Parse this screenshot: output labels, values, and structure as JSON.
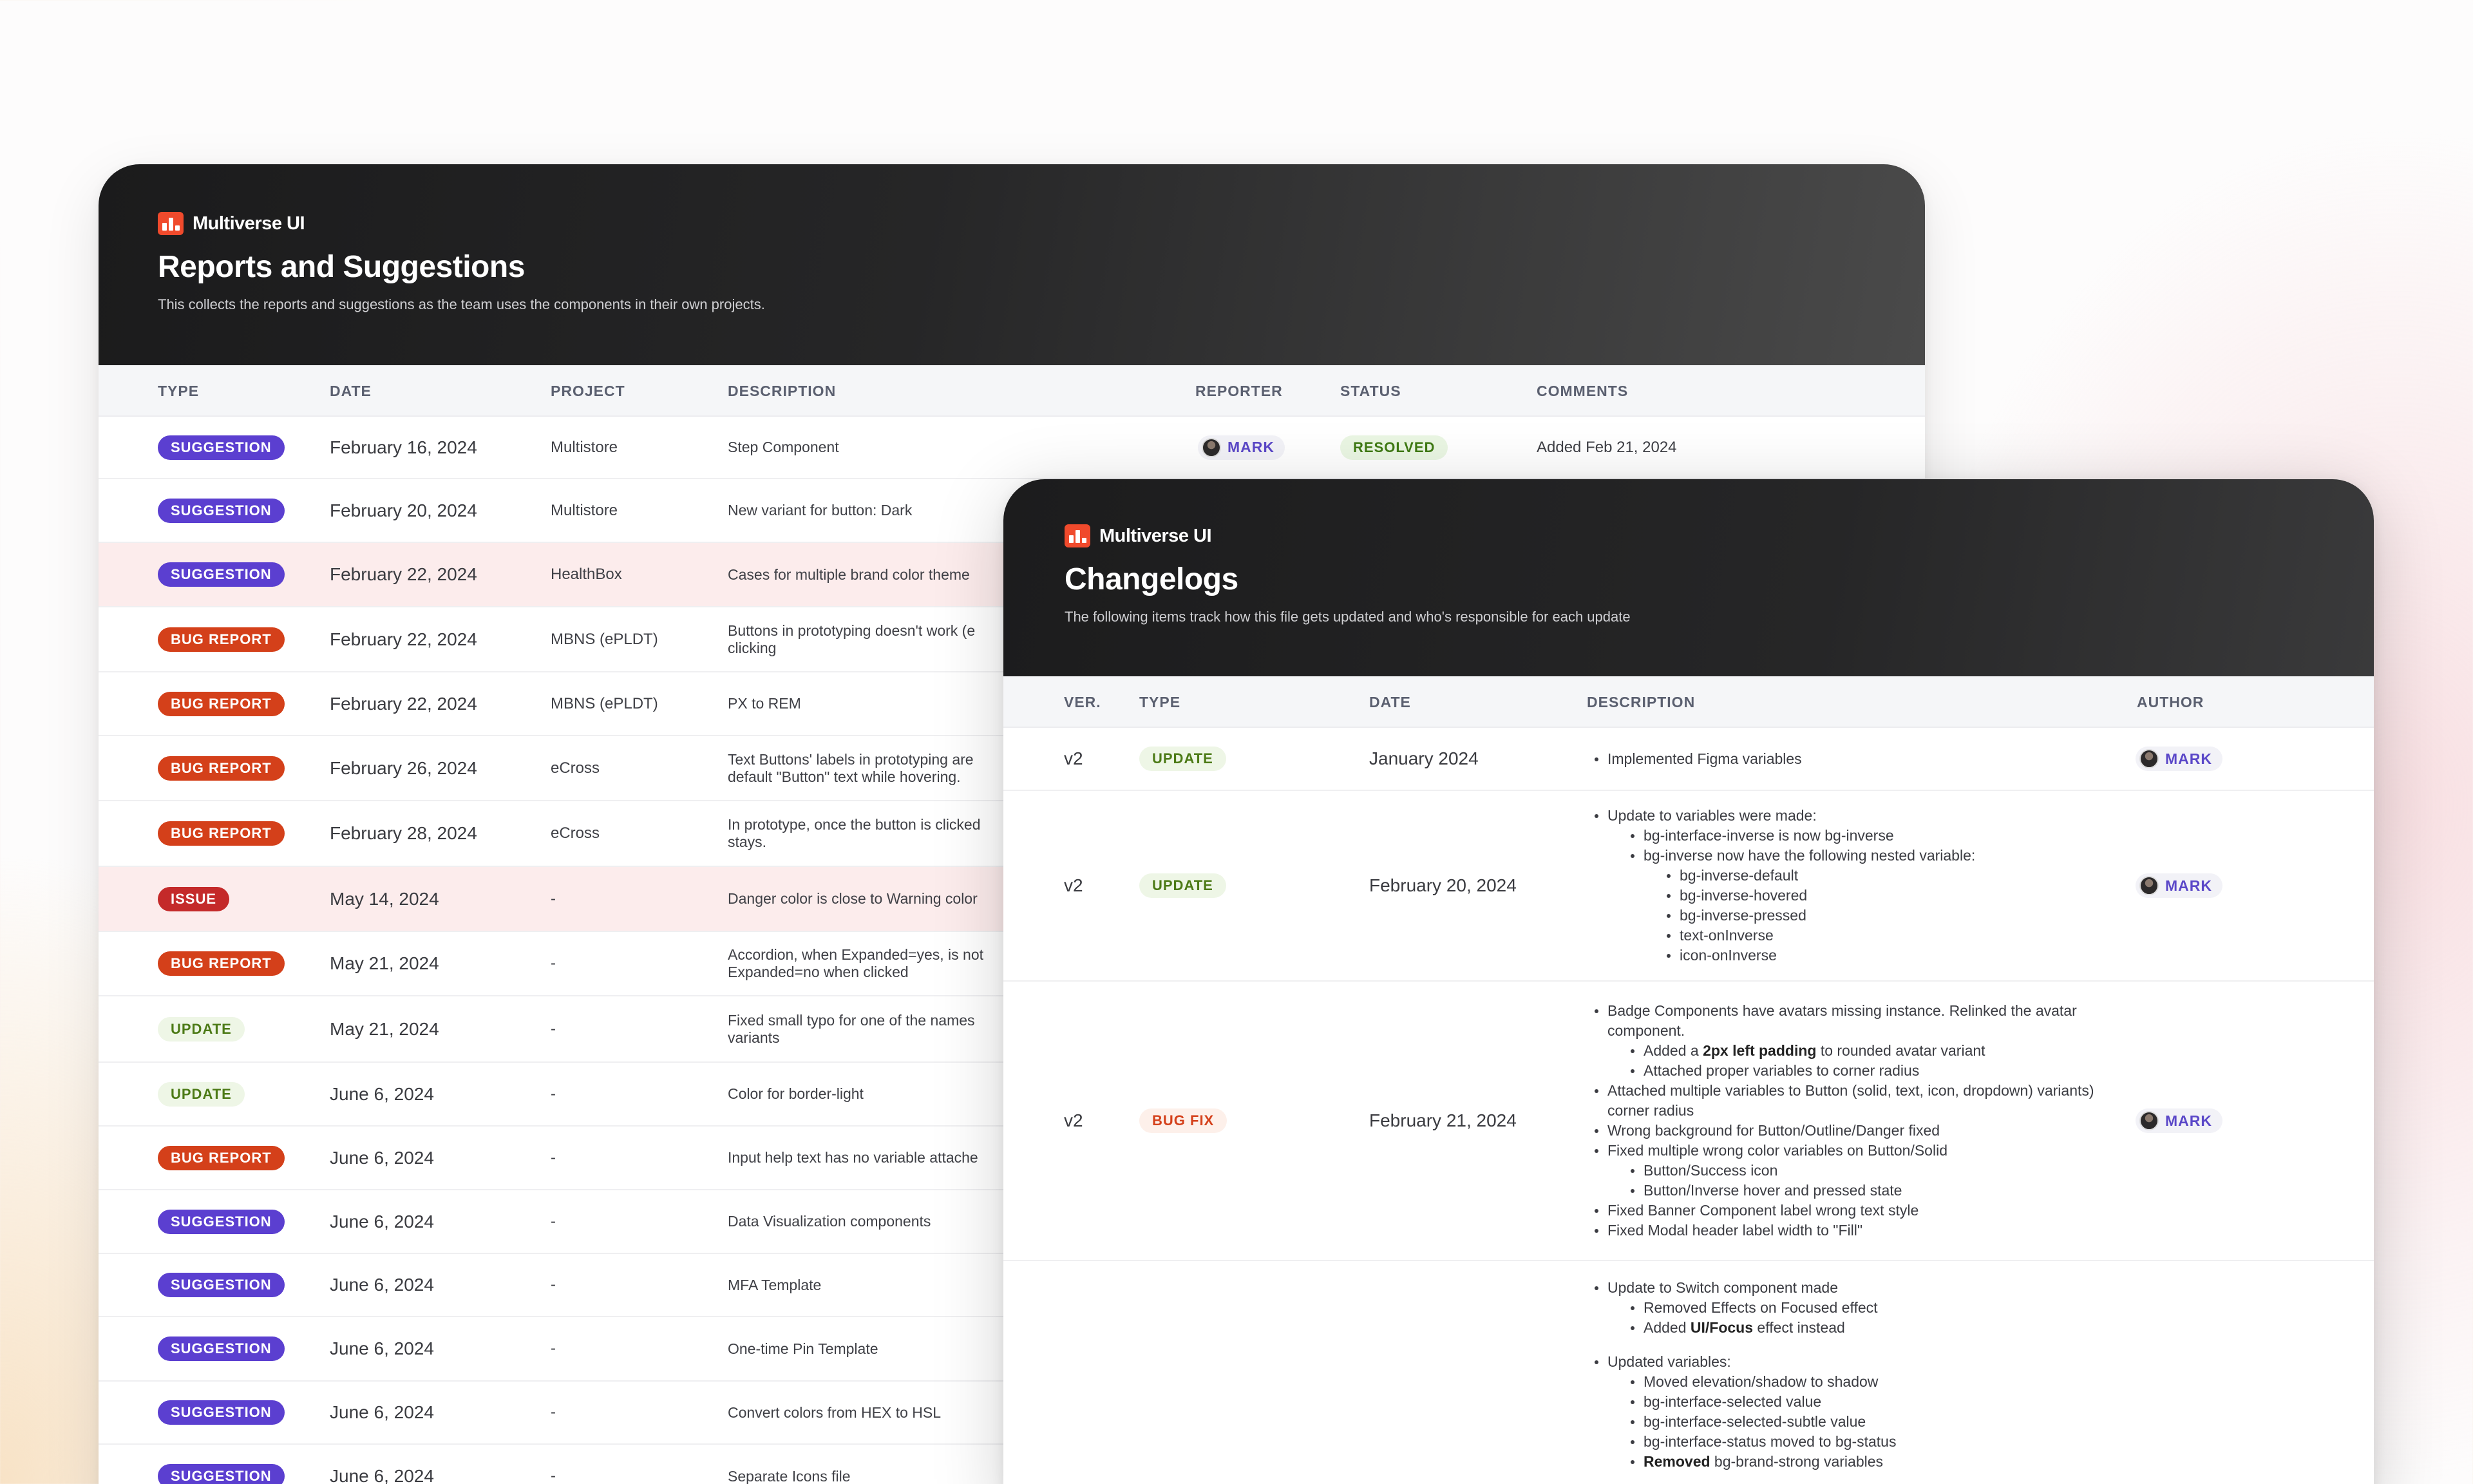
{
  "reports": {
    "brand": "Multiverse UI",
    "title": "Reports and Suggestions",
    "subtitle": "This collects the reports and suggestions as the team uses the components in their own projects.",
    "columns": {
      "type": "TYPE",
      "date": "DATE",
      "project": "PROJECT",
      "description": "DESCRIPTION",
      "reporter": "REPORTER",
      "status": "STATUS",
      "comments": "COMMENTS"
    },
    "rows": [
      {
        "type": "SUGGESTION",
        "kind": "suggestion",
        "date": "February 16, 2024",
        "project": "Multistore",
        "description": "Step Component",
        "reporter": "MARK",
        "status": "RESOLVED",
        "comments": "Added Feb 21, 2024",
        "highlight": false
      },
      {
        "type": "SUGGESTION",
        "kind": "suggestion",
        "date": "February 20, 2024",
        "project": "Multistore",
        "description": "New variant for button: Dark",
        "highlight": false
      },
      {
        "type": "SUGGESTION",
        "kind": "suggestion",
        "date": "February 22, 2024",
        "project": "HealthBox",
        "description": "Cases for multiple brand color theme",
        "highlight": true
      },
      {
        "type": "BUG REPORT",
        "kind": "bug",
        "date": "February 22, 2024",
        "project": "MBNS (ePLDT)",
        "description": "Buttons in prototyping doesn't work (e\nclicking",
        "highlight": false
      },
      {
        "type": "BUG REPORT",
        "kind": "bug",
        "date": "February 22, 2024",
        "project": "MBNS (ePLDT)",
        "description": "PX to REM",
        "highlight": false
      },
      {
        "type": "BUG REPORT",
        "kind": "bug",
        "date": "February 26, 2024",
        "project": "eCross",
        "description": "Text Buttons' labels in prototyping are\ndefault \"Button\" text while hovering.",
        "highlight": false
      },
      {
        "type": "BUG REPORT",
        "kind": "bug",
        "date": "February 28, 2024",
        "project": "eCross",
        "description": "In prototype, once the button is clicked\nstays.",
        "highlight": false
      },
      {
        "type": "ISSUE",
        "kind": "issue",
        "date": "May 14, 2024",
        "project": "-",
        "description": "Danger color is close to Warning color",
        "highlight": true
      },
      {
        "type": "BUG REPORT",
        "kind": "bug",
        "date": "May 21, 2024",
        "project": "-",
        "description": "Accordion, when Expanded=yes, is not\nExpanded=no when clicked",
        "highlight": false
      },
      {
        "type": "UPDATE",
        "kind": "update",
        "date": "May 21, 2024",
        "project": "-",
        "description": "Fixed small typo for one of the names\nvariants",
        "highlight": false
      },
      {
        "type": "UPDATE",
        "kind": "update",
        "date": "June 6, 2024",
        "project": "-",
        "description": "Color for border-light",
        "highlight": false
      },
      {
        "type": "BUG REPORT",
        "kind": "bug",
        "date": "June 6, 2024",
        "project": "-",
        "description": "Input help text has no variable attache",
        "highlight": false
      },
      {
        "type": "SUGGESTION",
        "kind": "suggestion",
        "date": "June 6, 2024",
        "project": "-",
        "description": "Data Visualization components",
        "highlight": false
      },
      {
        "type": "SUGGESTION",
        "kind": "suggestion",
        "date": "June 6, 2024",
        "project": "-",
        "description": "MFA Template",
        "highlight": false
      },
      {
        "type": "SUGGESTION",
        "kind": "suggestion",
        "date": "June 6, 2024",
        "project": "-",
        "description": "One-time Pin Template",
        "highlight": false
      },
      {
        "type": "SUGGESTION",
        "kind": "suggestion",
        "date": "June 6, 2024",
        "project": "-",
        "description": "Convert colors from HEX to HSL",
        "highlight": false
      },
      {
        "type": "SUGGESTION",
        "kind": "suggestion",
        "date": "June 6, 2024",
        "project": "-",
        "description": "Separate Icons file",
        "highlight": false
      }
    ]
  },
  "changelogs": {
    "brand": "Multiverse UI",
    "title": "Changelogs",
    "subtitle": "The following items track how this file gets updated and who's responsible for each update",
    "columns": {
      "ver": "VER.",
      "type": "TYPE",
      "date": "DATE",
      "description": "DESCRIPTION",
      "author": "AUTHOR"
    },
    "rows": [
      {
        "ver": "v2",
        "type": "UPDATE",
        "kind": "update",
        "date": "January 2024",
        "author": "MARK",
        "description": [
          {
            "t": "Implemented Figma variables"
          }
        ]
      },
      {
        "ver": "v2",
        "type": "UPDATE",
        "kind": "update",
        "date": "February 20, 2024",
        "author": "MARK",
        "description": [
          {
            "t": "Update to variables were made:",
            "children": [
              {
                "t": "bg-interface-inverse is now bg-inverse"
              },
              {
                "t": "bg-inverse now have the following nested variable:",
                "children": [
                  {
                    "t": "bg-inverse-default"
                  },
                  {
                    "t": "bg-inverse-hovered"
                  },
                  {
                    "t": "bg-inverse-pressed"
                  },
                  {
                    "t": "text-onInverse"
                  },
                  {
                    "t": "icon-onInverse"
                  }
                ]
              }
            ]
          }
        ]
      },
      {
        "ver": "v2",
        "type": "BUG FIX",
        "kind": "bugfix",
        "date": "February 21, 2024",
        "author": "MARK",
        "description": [
          {
            "t": "Badge Components have avatars missing instance. Relinked the avatar component.",
            "children": [
              {
                "t": "Added a ",
                "b": "2px left padding",
                "a": " to rounded avatar variant"
              },
              {
                "t": "Attached proper variables to corner radius"
              }
            ]
          },
          {
            "t": "Attached multiple variables to Button (solid, text, icon, dropdown) variants) corner radius"
          },
          {
            "t": "Wrong background for Button/Outline/Danger fixed"
          },
          {
            "t": "Fixed multiple wrong color variables on Button/Solid",
            "children": [
              {
                "t": "Button/Success icon"
              },
              {
                "t": "Button/Inverse hover and pressed state"
              }
            ]
          },
          {
            "t": "Fixed Banner Component label wrong text style"
          },
          {
            "t": "Fixed Modal header label width to \"Fill\""
          }
        ]
      },
      {
        "ver": "",
        "type": "",
        "kind": "",
        "date": "",
        "author": "",
        "description": [
          {
            "t": "Update to Switch component made",
            "children": [
              {
                "t": "Removed Effects on Focused effect"
              },
              {
                "t": "Added ",
                "b": "UI/Focus",
                "a": " effect instead"
              }
            ]
          },
          {
            "gap": true
          },
          {
            "t": "Updated variables:",
            "children": [
              {
                "t": "Moved elevation/shadow to shadow"
              },
              {
                "t": "bg-interface-selected value"
              },
              {
                "t": "bg-interface-selected-subtle value"
              },
              {
                "t": "bg-interface-status moved to bg-status"
              },
              {
                "t": "",
                "b": "Removed",
                "a": " bg-brand-strong variables"
              }
            ]
          }
        ]
      }
    ]
  }
}
